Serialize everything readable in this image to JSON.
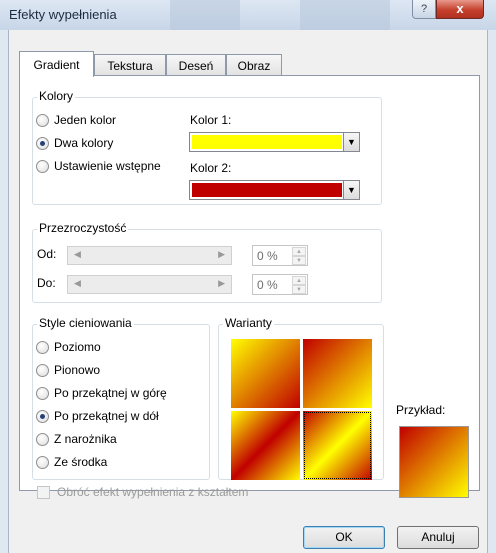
{
  "window": {
    "title": "Efekty wypełnienia",
    "help_glyph": "?",
    "close_glyph": "x"
  },
  "tabs": [
    {
      "label": "Gradient",
      "active": true
    },
    {
      "label": "Tekstura",
      "active": false
    },
    {
      "label": "Deseń",
      "active": false
    },
    {
      "label": "Obraz",
      "active": false
    }
  ],
  "colors_group": {
    "label": "Kolory",
    "options": [
      {
        "label": "Jeden kolor",
        "selected": false
      },
      {
        "label": "Dwa kolory",
        "selected": true
      },
      {
        "label": "Ustawienie wstępne",
        "selected": false
      }
    ],
    "color1_label": "Kolor 1:",
    "color1_value": "#ffff00",
    "color2_label": "Kolor 2:",
    "color2_value": "#c00000",
    "dropdown_glyph": "▼"
  },
  "transparency_group": {
    "label": "Przezroczystość",
    "from_label": "Od:",
    "to_label": "Do:",
    "from_value": "0 %",
    "to_value": "0 %"
  },
  "shading_group": {
    "label": "Style cieniowania",
    "options": [
      {
        "label": "Poziomo",
        "selected": false
      },
      {
        "label": "Pionowo",
        "selected": false
      },
      {
        "label": "Po przekątnej w górę",
        "selected": false
      },
      {
        "label": "Po przekątnej w dół",
        "selected": true
      },
      {
        "label": "Z narożnika",
        "selected": false
      },
      {
        "label": "Ze środka",
        "selected": false
      }
    ]
  },
  "variants_group": {
    "label": "Warianty",
    "selected_index": 3
  },
  "sample": {
    "label": "Przykład:"
  },
  "rotate_checkbox": {
    "label": "Obróć efekt wypełnienia z kształtem",
    "checked": false,
    "enabled": false
  },
  "buttons": {
    "ok": "OK",
    "cancel": "Anuluj"
  }
}
